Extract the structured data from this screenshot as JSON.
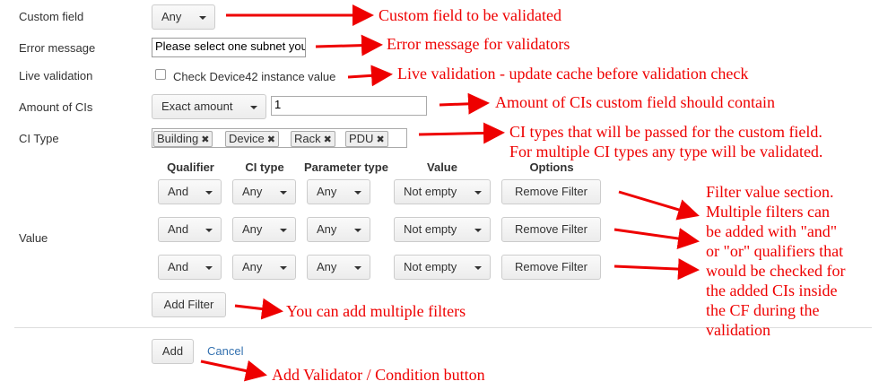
{
  "form": {
    "custom_field_label": "Custom field",
    "custom_field_value": "Any",
    "error_message_label": "Error message",
    "error_message_value": "Please select one subnet you",
    "live_validation_label": "Live validation",
    "live_validation_checkbox_label": "Check Device42 instance value",
    "live_validation_checked": false,
    "amount_label": "Amount of CIs",
    "amount_select_value": "Exact amount",
    "amount_input_value": "1",
    "ci_type_label": "CI Type",
    "ci_types": [
      "Building",
      "Device",
      "Rack",
      "PDU"
    ],
    "value_label": "Value",
    "add_button": "Add",
    "cancel_link": "Cancel"
  },
  "filters": {
    "headers": [
      "Qualifier",
      "CI type",
      "Parameter type",
      "Value",
      "Options"
    ],
    "rows": [
      {
        "qualifier": "And",
        "ci_type": "Any",
        "parameter_type": "Any",
        "value": "Not empty",
        "action": "Remove Filter"
      },
      {
        "qualifier": "And",
        "ci_type": "Any",
        "parameter_type": "Any",
        "value": "Not empty",
        "action": "Remove Filter"
      },
      {
        "qualifier": "And",
        "ci_type": "Any",
        "parameter_type": "Any",
        "value": "Not empty",
        "action": "Remove Filter"
      }
    ],
    "add_filter_button": "Add Filter"
  },
  "annotations": {
    "custom_field": "Custom field to be validated",
    "error_message": "Error message for validators",
    "live_validation": "Live validation - update cache before validation check",
    "amount": "Amount of CIs custom field should contain",
    "ci_type_line1": "CI types that will be passed for the custom field.",
    "ci_type_line2": "For multiple CI types any type will be validated.",
    "filter_lines": [
      "Filter value section.",
      "Multiple filters can",
      "be added with \"and\"",
      "or \"or\" qualifiers that",
      "would be checked for",
      "the added CIs inside",
      "the CF during the",
      "validation"
    ],
    "add_filter": "You can add multiple filters",
    "add_button": "Add Validator / Condition button"
  },
  "colors": {
    "annotation": "#e00000",
    "link": "#3572b0"
  }
}
